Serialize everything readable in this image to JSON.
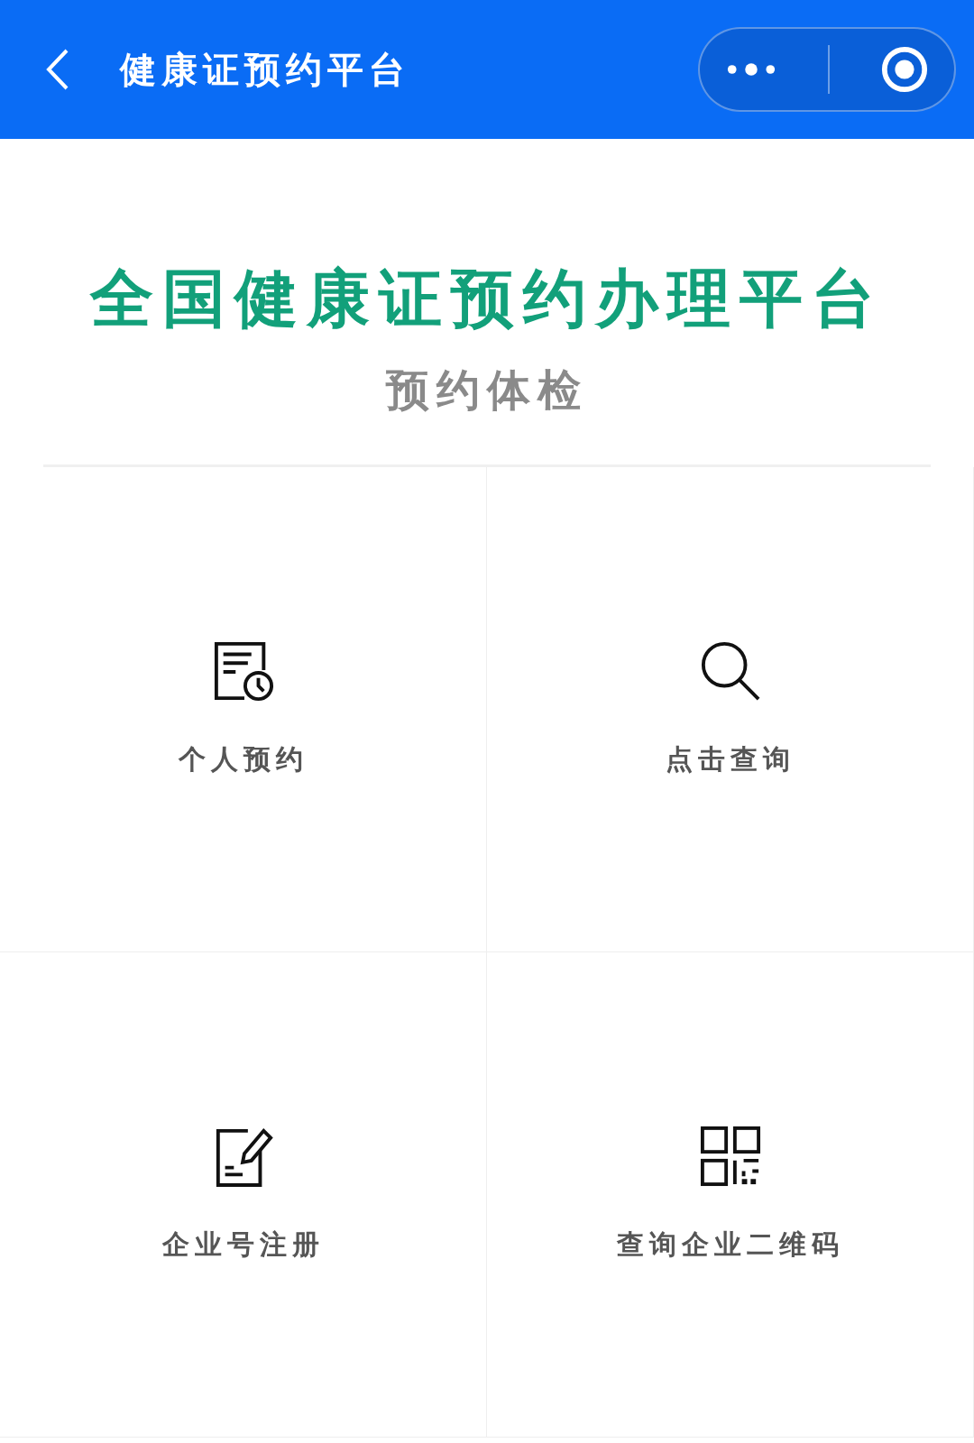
{
  "nav_bar": {
    "title": "健康证预约平台"
  },
  "banner": {
    "title": "全国健康证预约办理平台",
    "subtitle": "预约体检"
  },
  "tiles": [
    {
      "label": "个人预约",
      "kind": "appointment"
    },
    {
      "label": "点击查询",
      "kind": "search"
    },
    {
      "label": "企业号注册",
      "kind": "register"
    },
    {
      "label": "查询企业二维码",
      "kind": "qrcode"
    }
  ]
}
